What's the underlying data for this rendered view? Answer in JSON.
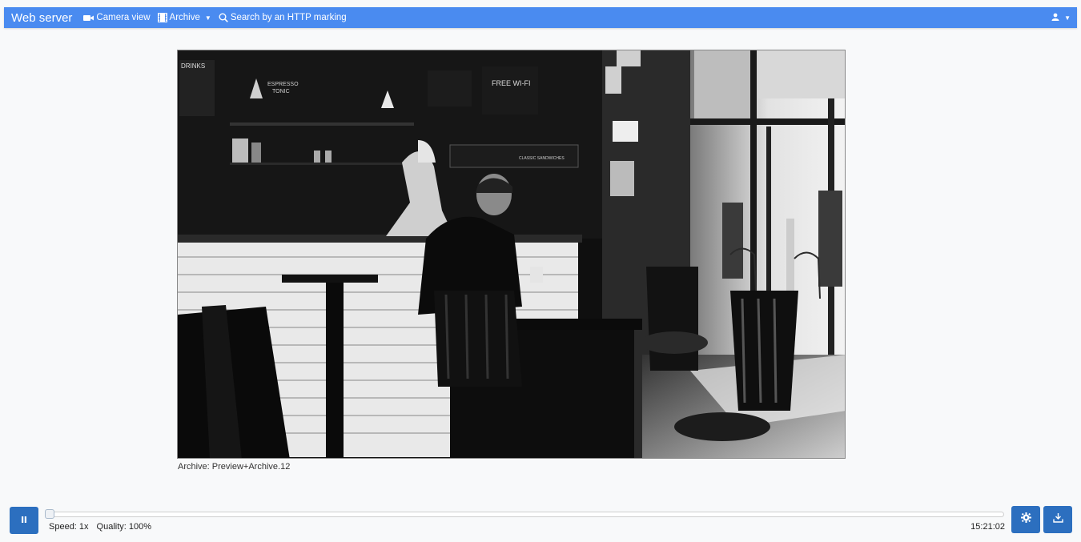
{
  "header": {
    "brand": "Web server",
    "nav": [
      {
        "label": "Camera view",
        "icon": "camera-icon"
      },
      {
        "label": "Archive",
        "icon": "film-icon",
        "dropdown": true
      },
      {
        "label": "Search by an HTTP marking",
        "icon": "search-icon"
      }
    ],
    "user_icon": "user-icon"
  },
  "video": {
    "caption": "Archive: Preview+Archive.12",
    "signs": {
      "drinks": "DRINKS",
      "espresso": "ESPRESSO",
      "tonic": "TONIC",
      "free_wifi": "FREE WI-FI",
      "classic": "CLASSIC SANDWICHES"
    }
  },
  "player": {
    "status_speed": "Speed: 1x",
    "status_quality": "Quality: 100%",
    "time": "15:21:02",
    "progress": 0.0
  },
  "colors": {
    "topbar": "#4a8bf0",
    "button": "#2c6fbf"
  }
}
